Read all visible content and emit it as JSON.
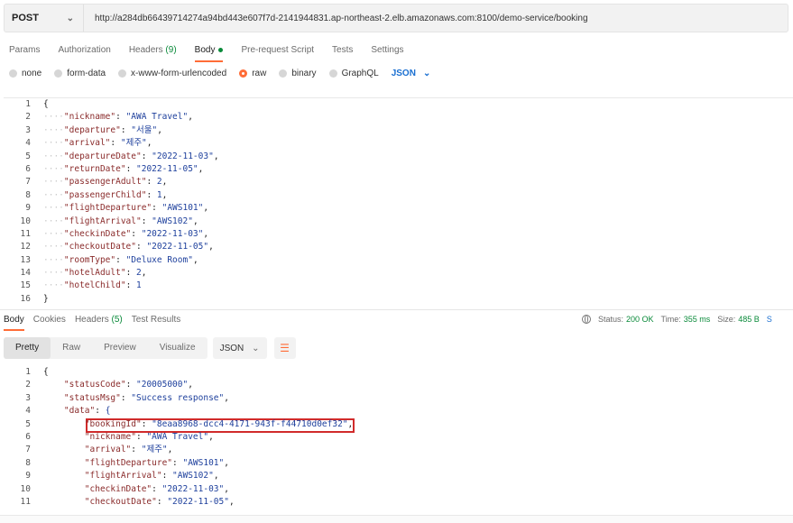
{
  "request": {
    "method": "POST",
    "url": "http://a284db66439714274a94bd443e607f7d-2141944831.ap-northeast-2.elb.amazonaws.com:8100/demo-service/booking"
  },
  "request_tabs": [
    {
      "label": "Params",
      "count": ""
    },
    {
      "label": "Authorization",
      "count": ""
    },
    {
      "label": "Headers",
      "count": "(9)"
    },
    {
      "label": "Body",
      "count": ""
    },
    {
      "label": "Pre-request Script",
      "count": ""
    },
    {
      "label": "Tests",
      "count": ""
    },
    {
      "label": "Settings",
      "count": ""
    }
  ],
  "body_modes": [
    "none",
    "form-data",
    "x-www-form-urlencoded",
    "raw",
    "binary",
    "GraphQL"
  ],
  "body_format": "JSON",
  "request_body": [
    {
      "t": "{"
    },
    {
      "k": "nickname",
      "v": "\"AWA Travel\"",
      "c": true
    },
    {
      "k": "departure",
      "v": "\"서울\"",
      "c": true
    },
    {
      "k": "arrival",
      "v": "\"제주\"",
      "c": true
    },
    {
      "k": "departureDate",
      "v": "\"2022-11-03\"",
      "c": true
    },
    {
      "k": "returnDate",
      "v": "\"2022-11-05\"",
      "c": true
    },
    {
      "k": "passengerAdult",
      "v": "2",
      "c": true
    },
    {
      "k": "passengerChild",
      "v": "1",
      "c": true
    },
    {
      "k": "flightDeparture",
      "v": "\"AWS101\"",
      "c": true
    },
    {
      "k": "flightArrival",
      "v": "\"AWS102\"",
      "c": true
    },
    {
      "k": "checkinDate",
      "v": "\"2022-11-03\"",
      "c": true
    },
    {
      "k": "checkoutDate",
      "v": "\"2022-11-05\"",
      "c": true
    },
    {
      "k": "roomType",
      "v": "\"Deluxe Room\"",
      "c": true
    },
    {
      "k": "hotelAdult",
      "v": "2",
      "c": true
    },
    {
      "k": "hotelChild",
      "v": "1",
      "c": false
    },
    {
      "t": "}"
    }
  ],
  "response_tabs": [
    {
      "label": "Body",
      "count": ""
    },
    {
      "label": "Cookies",
      "count": ""
    },
    {
      "label": "Headers",
      "count": "(5)"
    },
    {
      "label": "Test Results",
      "count": ""
    }
  ],
  "response_stats": {
    "status_label": "Status:",
    "status_value": "200 OK",
    "time_label": "Time:",
    "time_value": "355 ms",
    "size_label": "Size:",
    "size_value": "485 B",
    "save_label": "S"
  },
  "view_modes": [
    "Pretty",
    "Raw",
    "Preview",
    "Visualize"
  ],
  "response_format": "JSON",
  "response_body": [
    {
      "t": "{"
    },
    {
      "k": "statusCode",
      "v": "\"20005000\"",
      "c": true,
      "i": 1
    },
    {
      "k": "statusMsg",
      "v": "\"Success response\"",
      "c": true,
      "i": 1
    },
    {
      "k": "data",
      "v": "{",
      "c": false,
      "i": 1
    },
    {
      "k": "bookingId",
      "v": "\"8eaa8968-dcc4-4171-943f-f44710d0ef32\"",
      "c": true,
      "i": 2
    },
    {
      "k": "nickname",
      "v": "\"AWA Travel\"",
      "c": true,
      "i": 2
    },
    {
      "k": "arrival",
      "v": "\"제주\"",
      "c": true,
      "i": 2
    },
    {
      "k": "flightDeparture",
      "v": "\"AWS101\"",
      "c": true,
      "i": 2
    },
    {
      "k": "flightArrival",
      "v": "\"AWS102\"",
      "c": true,
      "i": 2
    },
    {
      "k": "checkinDate",
      "v": "\"2022-11-03\"",
      "c": true,
      "i": 2
    },
    {
      "k": "checkoutDate",
      "v": "\"2022-11-05\"",
      "c": true,
      "i": 2
    }
  ],
  "colors": {
    "accent": "#ff6c37",
    "success": "#0a8a3a",
    "link": "#1a6fd1",
    "highlight_box": "#d12b2b"
  }
}
